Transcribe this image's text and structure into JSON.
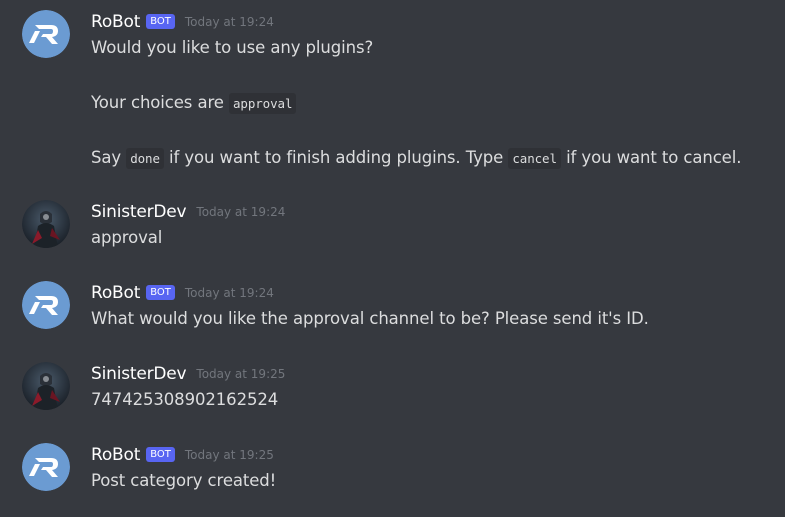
{
  "messages": [
    {
      "author": "RoBot",
      "bot_tag": "BOT",
      "timestamp": "Today at 19:24",
      "line1": "Would you like to use any plugins?",
      "line2_prefix": "Your choices are ",
      "line2_code": "approval",
      "line3_a": "Say ",
      "line3_code1": "done",
      "line3_b": " if you want to finish adding plugins. Type ",
      "line3_code2": "cancel",
      "line3_c": " if you want to cancel."
    },
    {
      "author": "SinisterDev",
      "timestamp": "Today at 19:24",
      "text": "approval"
    },
    {
      "author": "RoBot",
      "bot_tag": "BOT",
      "timestamp": "Today at 19:24",
      "text": "What would you like the approval channel to be? Please send it's ID."
    },
    {
      "author": "SinisterDev",
      "timestamp": "Today at 19:25",
      "text": "747425308902162524"
    },
    {
      "author": "RoBot",
      "bot_tag": "BOT",
      "timestamp": "Today at 19:25",
      "text": "Post category created!"
    }
  ],
  "avatars": {
    "bot": "robot-logo-icon",
    "user": "sinisterdev-avatar-icon",
    "bot_color": "#6b9bd2",
    "user_color": "#2c3e50"
  },
  "colors": {
    "background": "#36393f",
    "bot_tag": "#5865f2",
    "timestamp": "#72767d",
    "text": "#dcddde",
    "username": "#ffffff"
  }
}
